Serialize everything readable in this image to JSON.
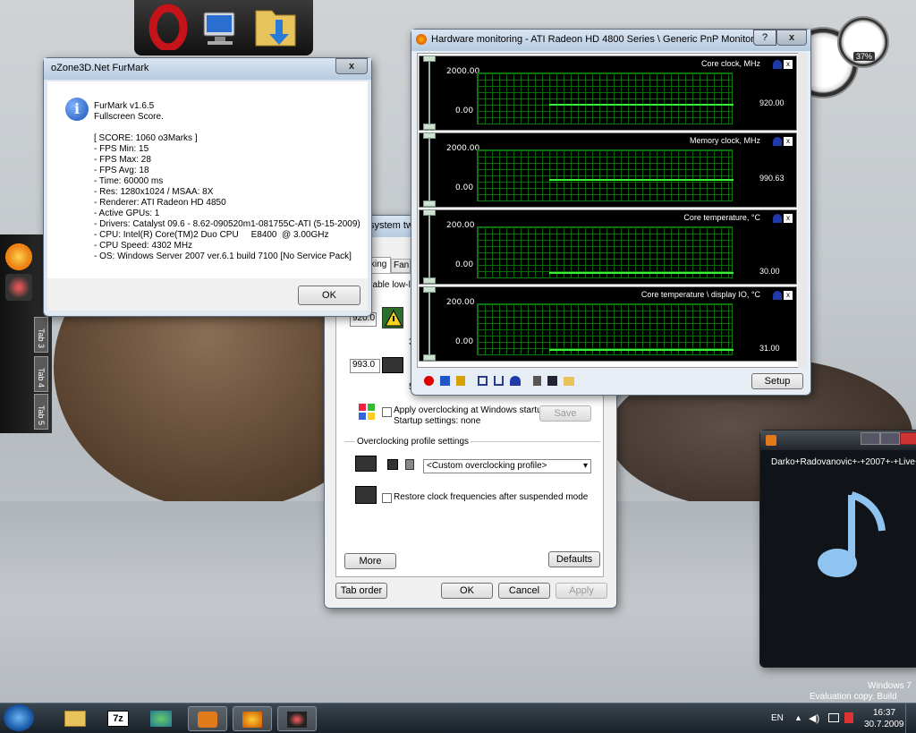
{
  "desktop": {
    "watermark_line1": "Windows 7",
    "watermark_line2": "Evaluation copy. Build 7100"
  },
  "furmark": {
    "title": "oZone3D.Net FurMark",
    "close_label": "x",
    "lines": [
      "FurMark v1.6.5",
      "Fullscreen Score.",
      "",
      "[ SCORE: 1060 o3Marks ]",
      "- FPS Min: 15",
      "- FPS Max: 28",
      "- FPS Avg: 18",
      "- Time: 60000 ms",
      "- Res: 1280x1024 / MSAA: 8X",
      "- Renderer: ATI Radeon HD 4850",
      "- Active GPUs: 1",
      "- Drivers: Catalyst 09.6 - 8.62-090520m1-081755C-ATI (5-15-2009)",
      "- CPU: Intel(R) Core(TM)2 Duo CPU     E8400  @ 3.00GHz",
      "- CPU Speed: 4302 MHz",
      "- OS: Windows Server 2007 ver.6.1 build 7100 [No Service Pack]"
    ],
    "ok_label": "OK"
  },
  "hwmon": {
    "title": "Hardware monitoring - ATI Radeon HD 4800 Series  \\ Generic PnP Monitor",
    "help_label": "?",
    "close_label": "x",
    "graphs": [
      {
        "title": "Core clock, MHz",
        "ymax": "2000.00",
        "ymin": "0.00",
        "value": "920.00",
        "level": 0.46
      },
      {
        "title": "Memory clock, MHz",
        "ymax": "2000.00",
        "ymin": "0.00",
        "value": "990.63",
        "level": 0.495
      },
      {
        "title": "Core temperature, °C",
        "ymax": "200.00",
        "ymin": "0.00",
        "value": "30.00",
        "level": 0.15
      },
      {
        "title": "Core temperature \\ display IO, °C",
        "ymax": "200.00",
        "ymin": "0.00",
        "value": "31.00",
        "level": 0.155
      }
    ],
    "setup_label": "Setup"
  },
  "settings": {
    "title": "system twe",
    "tab1": "king",
    "tab2": "Fan",
    "partial_text": "nable low-le",
    "field1": "920.0",
    "field2": "993.0",
    "small3": "3",
    "small5": "5",
    "apply_checkbox": "Apply overclocking at Windows startup",
    "startup_settings": "Startup settings: none",
    "save_label": "Save",
    "profile_group": "Overclocking profile settings",
    "profile_select": "<Custom overclocking profile>",
    "restore_checkbox": "Restore clock frequencies after suspended mode",
    "more_label": "More",
    "defaults_label": "Defaults",
    "taborder_label": "Tab order",
    "ok_label": "OK",
    "cancel_label": "Cancel",
    "apply_label": "Apply"
  },
  "tabs_side": [
    "Tab 3",
    "Tab 4",
    "Tab 5"
  ],
  "gadget": {
    "cpu_percent": "37%"
  },
  "media": {
    "title_text": "Darko+Radovanovic+-+2007+-+Live+"
  },
  "taskbar": {
    "language": "EN",
    "time": "16:37",
    "date": "30.7.2009"
  }
}
